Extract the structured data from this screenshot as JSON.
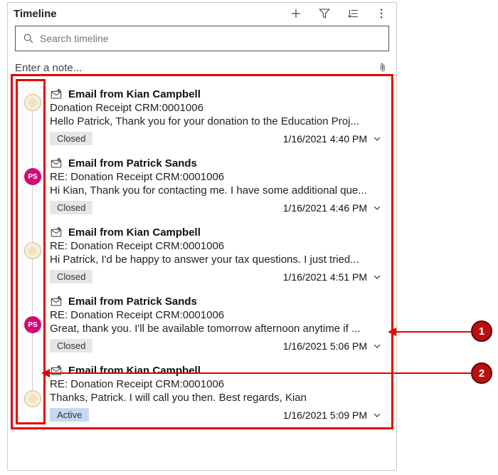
{
  "header": {
    "title": "Timeline"
  },
  "search": {
    "placeholder": "Search timeline"
  },
  "note": {
    "placeholder": "Enter a note..."
  },
  "entries": [
    {
      "avType": "gold",
      "title": "Email from Kian Campbell",
      "subject": "Donation Receipt CRM:0001006",
      "body": "Hello Patrick,   Thank you for your donation to the Education Proj...",
      "status": "Closed",
      "date": "1/16/2021 4:40 PM"
    },
    {
      "avType": "pink",
      "avText": "PS",
      "title": "Email from Patrick Sands",
      "subject": "RE: Donation Receipt CRM:0001006",
      "body": "Hi Kian, Thank you for contacting me. I have some additional que...",
      "status": "Closed",
      "date": "1/16/2021 4:46 PM"
    },
    {
      "avType": "gold",
      "title": "Email from Kian Campbell",
      "subject": "RE: Donation Receipt CRM:0001006",
      "body": "Hi Patrick,   I'd be happy to answer your tax questions. I just tried...",
      "status": "Closed",
      "date": "1/16/2021 4:51 PM"
    },
    {
      "avType": "pink",
      "avText": "PS",
      "title": "Email from Patrick Sands",
      "subject": "RE: Donation Receipt CRM:0001006",
      "body": "Great, thank you. I'll be available tomorrow afternoon anytime if ...",
      "status": "Closed",
      "date": "1/16/2021 5:06 PM"
    },
    {
      "avType": "gold",
      "title": "Email from Kian Campbell",
      "subject": "RE: Donation Receipt CRM:0001006",
      "body": "Thanks, Patrick. I will call you then.   Best regards, Kian",
      "status": "Active",
      "date": "1/16/2021 5:09 PM"
    }
  ],
  "callouts": {
    "one": "1",
    "two": "2"
  }
}
